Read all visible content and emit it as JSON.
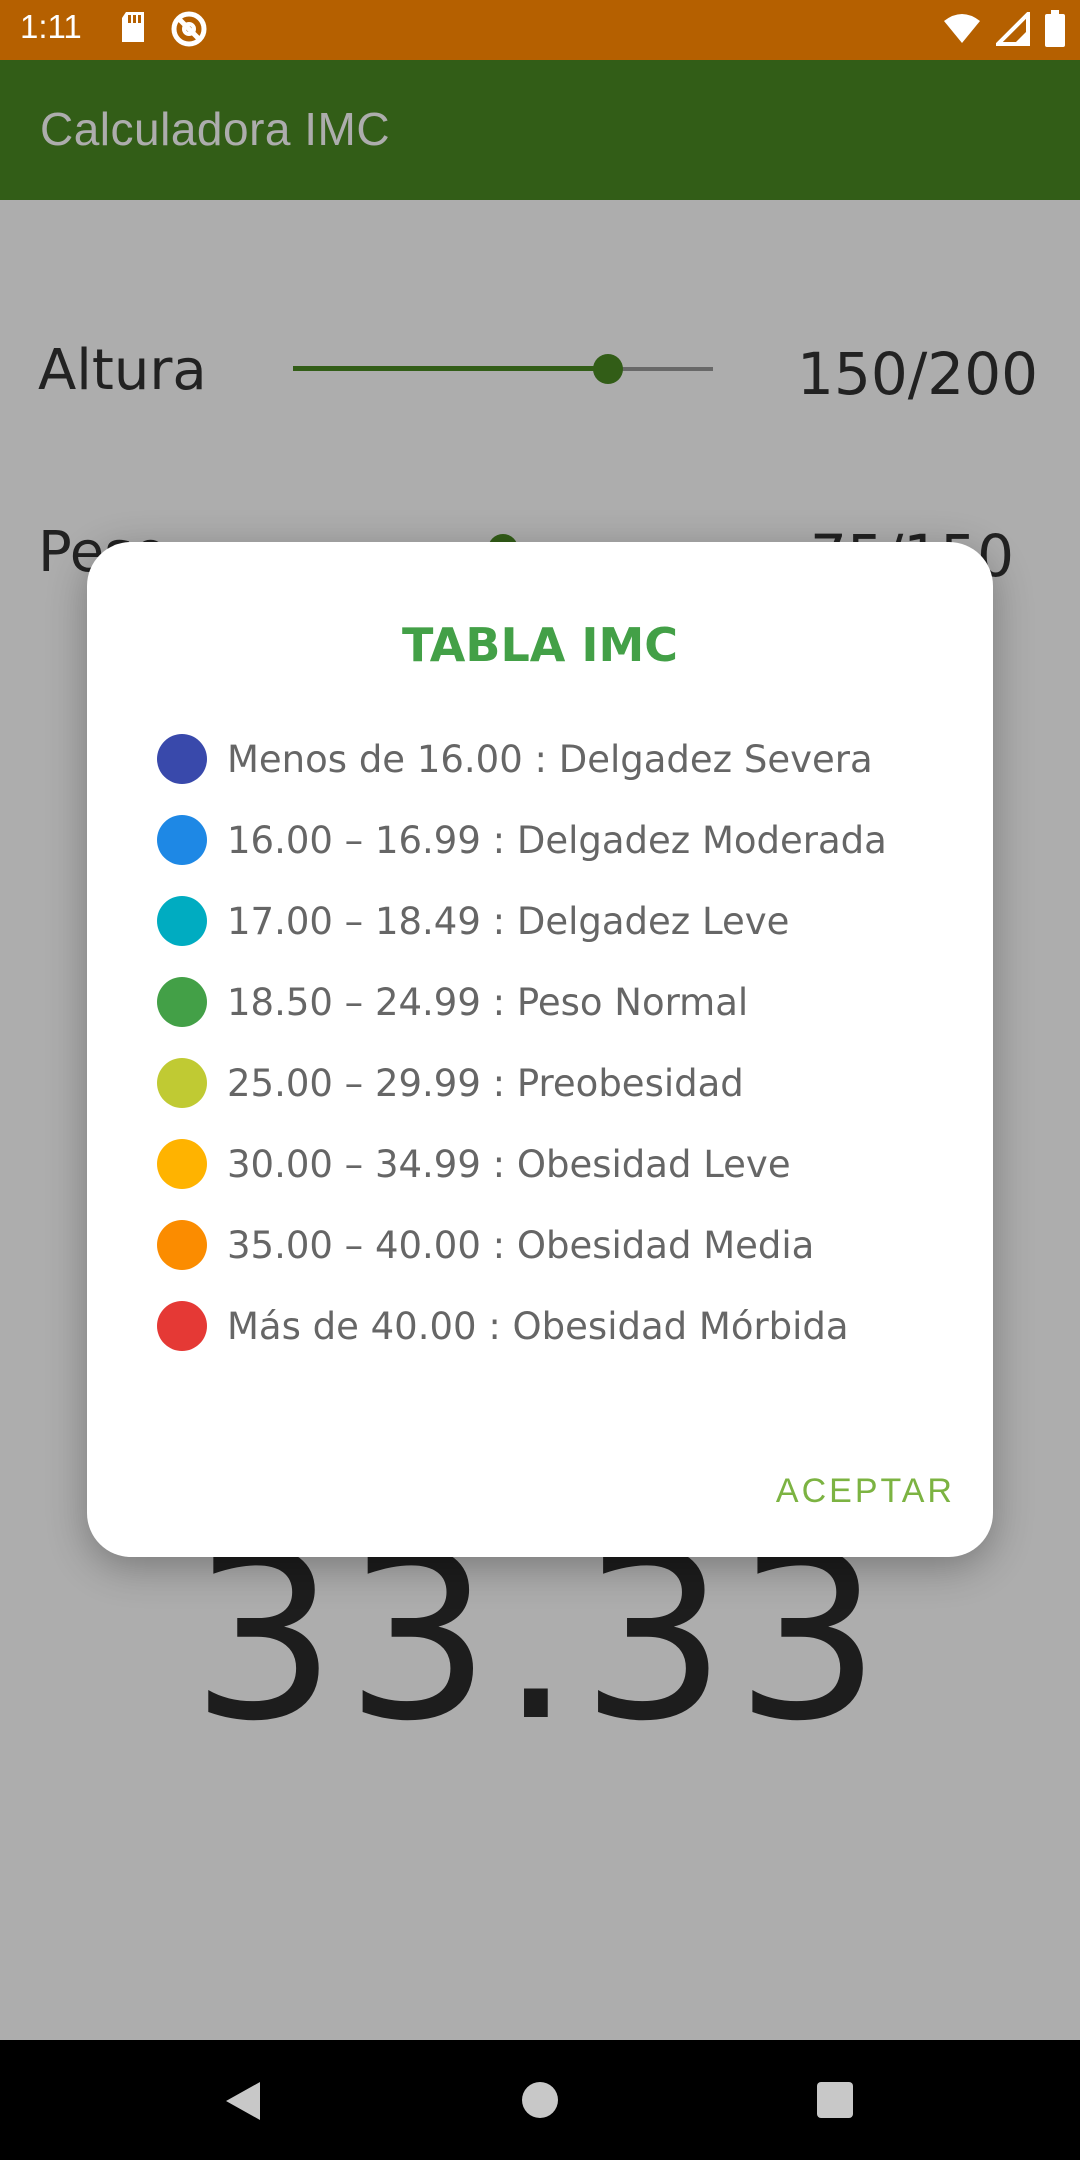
{
  "status_bar": {
    "time": "1:11",
    "left_icons": [
      "sd-card-icon",
      "do-not-disturb-icon"
    ],
    "right_icons": [
      "wifi-icon",
      "signal-icon",
      "battery-icon"
    ]
  },
  "app_bar": {
    "title": "Calculadora IMC"
  },
  "main": {
    "altura_label": "Altura",
    "altura_value": "150/200",
    "altura_slider_fraction": 0.75,
    "peso_label": "Peso",
    "peso_value": "75/150",
    "peso_slider_fraction": 0.5,
    "result": "33.33"
  },
  "dialog": {
    "title": "TABLA IMC",
    "rows": [
      {
        "text": "Menos de 16.00 : Delgadez Severa",
        "color": "#3949ab"
      },
      {
        "text": "16.00 – 16.99 : Delgadez Moderada",
        "color": "#1e88e5"
      },
      {
        "text": "17.00 – 18.49 : Delgadez Leve",
        "color": "#00acc1"
      },
      {
        "text": "18.50 – 24.99 : Peso Normal",
        "color": "#43a047"
      },
      {
        "text": "25.00 – 29.99 : Preobesidad",
        "color": "#c0ca33"
      },
      {
        "text": "30.00 – 34.99 : Obesidad Leve",
        "color": "#ffb300"
      },
      {
        "text": "35.00 – 40.00 : Obesidad Media",
        "color": "#fb8c00"
      },
      {
        "text": "Más de 40.00 : Obesidad Mórbida",
        "color": "#e53935"
      }
    ],
    "accept_label": "ACEPTAR"
  },
  "nav_bar": {
    "icons": [
      "back-icon",
      "home-icon",
      "recents-icon"
    ]
  }
}
